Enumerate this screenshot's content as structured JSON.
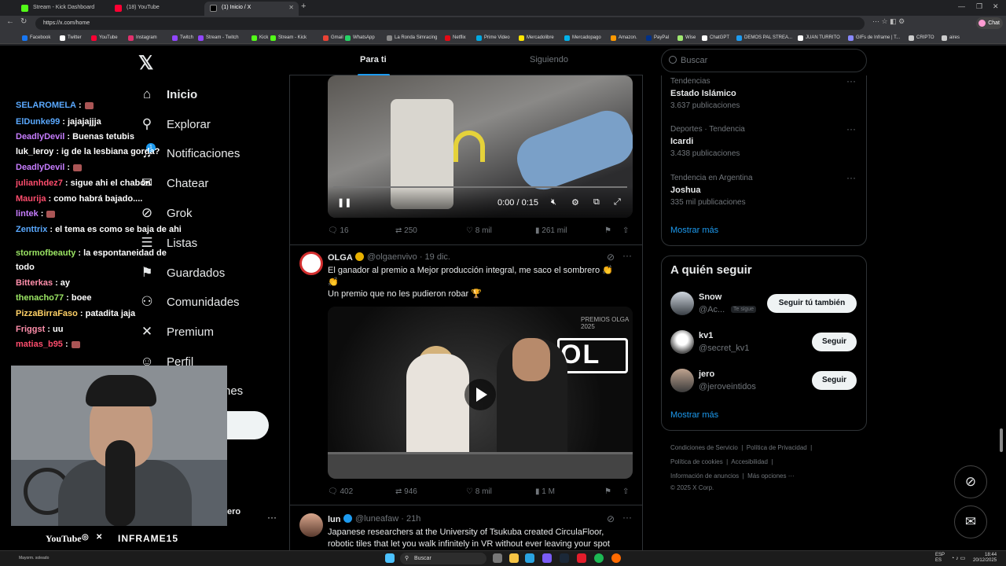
{
  "browser": {
    "tabs": [
      {
        "title": "Stream - Kick Dashboard",
        "color": "#53fc18"
      },
      {
        "title": "(18) YouTube",
        "color": "#ff0033"
      },
      {
        "title": "(1) Inicio / X",
        "color": "#000000"
      }
    ],
    "url": "https://x.com/home",
    "bookmarks": [
      {
        "label": "Facebook",
        "color": "#1877f2"
      },
      {
        "label": "Twitter",
        "color": "#ffffff"
      },
      {
        "label": "YouTube",
        "color": "#ff0033"
      },
      {
        "label": "Instagram",
        "color": "#e1306c"
      },
      {
        "label": "Twitch",
        "color": "#9146ff"
      },
      {
        "label": "Stream - Twitch",
        "color": "#9146ff"
      },
      {
        "label": "Kick",
        "color": "#53fc18"
      },
      {
        "label": "Stream - Kick",
        "color": "#53fc18"
      },
      {
        "label": "Gmail",
        "color": "#ea4335"
      },
      {
        "label": "WhatsApp",
        "color": "#25d366"
      },
      {
        "label": "La Ronda Simracing",
        "color": "#888888"
      },
      {
        "label": "Netflix",
        "color": "#e50914"
      },
      {
        "label": "Prime Video",
        "color": "#00a8e1"
      },
      {
        "label": "Mercadolibre",
        "color": "#ffe600"
      },
      {
        "label": "Mercadopago",
        "color": "#00b1ea"
      },
      {
        "label": "Amazon.",
        "color": "#ff9900"
      },
      {
        "label": "PayPal",
        "color": "#003087"
      },
      {
        "label": "Wise",
        "color": "#9fe870"
      },
      {
        "label": "ChatGPT",
        "color": "#ffffff"
      },
      {
        "label": "DEMOS PAL STREA...",
        "color": "#1d9bf0"
      },
      {
        "label": "JUAN TURRITO",
        "color": "#ffffff"
      },
      {
        "label": "GIFs de Inframe | T...",
        "color": "#8888ff"
      },
      {
        "label": "CRIPTO",
        "color": "#cccccc"
      },
      {
        "label": "aires",
        "color": "#cccccc"
      }
    ],
    "chat_button": "Chat"
  },
  "x_nav": {
    "items": [
      {
        "label": "Inicio",
        "icon": "home-icon",
        "glyph": "⌂"
      },
      {
        "label": "Explorar",
        "icon": "search-icon",
        "glyph": "⚲"
      },
      {
        "label": "Notificaciones",
        "icon": "bell-icon",
        "glyph": "♫"
      },
      {
        "label": "Chatear",
        "icon": "mail-icon",
        "glyph": "✉"
      },
      {
        "label": "Grok",
        "icon": "grok-icon",
        "glyph": "⊘"
      },
      {
        "label": "Listas",
        "icon": "list-icon",
        "glyph": "☰"
      },
      {
        "label": "Guardados",
        "icon": "bookmark-icon",
        "glyph": "⚑"
      },
      {
        "label": "Comunidades",
        "icon": "communities-icon",
        "glyph": "⚇"
      },
      {
        "label": "Premium",
        "icon": "x-icon",
        "glyph": "✕"
      },
      {
        "label": "Perfil",
        "icon": "profile-icon",
        "glyph": "☺"
      }
    ],
    "partial_label": "nes",
    "account_partial": "ero",
    "notification_count": "1"
  },
  "stream_chat": [
    {
      "user": "SELAROMELA",
      "color": "#5aa9ff",
      "msg": ":"
    },
    {
      "user": "ElDunke99",
      "color": "#5aa9ff",
      "msg": ": jajajajjja"
    },
    {
      "user": "DeadlyDevil",
      "color": "#c77dff",
      "msg": ": Buenas tetubis"
    },
    {
      "user": "luk_leroy",
      "color": "#ffffff",
      "msg": ": ig de la lesbiana gorda?"
    },
    {
      "user": "DeadlyDevil",
      "color": "#c77dff",
      "msg": ":"
    },
    {
      "user": "julianhdez7",
      "color": "#ff4d6d",
      "msg": ": sigue ahi el chabon"
    },
    {
      "user": "Maurija",
      "color": "#ff4d6d",
      "msg": ": como habrá bajado...."
    },
    {
      "user": "lintek",
      "color": "#c77dff",
      "msg": ":"
    },
    {
      "user": "Zenttrix",
      "color": "#5aa9ff",
      "msg": ": el tema es como se baja de ahi"
    },
    {
      "user": "stormofbeauty",
      "color": "#9be564",
      "msg": ": la espontaneidad de"
    },
    {
      "user": "",
      "color": "#ffffff",
      "msg": "todo"
    },
    {
      "user": "Bitterkas",
      "color": "#ff8fab",
      "msg": ": ay"
    },
    {
      "user": "thenacho77",
      "color": "#9be564",
      "msg": ": boee"
    },
    {
      "user": "PizzaBirraFaso",
      "color": "#ffd166",
      "msg": ": patadita jaja"
    },
    {
      "user": "Friggst",
      "color": "#ff8fab",
      "msg": ": uu"
    },
    {
      "user": "matias_b95",
      "color": "#ff4d6d",
      "msg": ":"
    }
  ],
  "webcam_footer": {
    "youtube": "YouTube",
    "handle": "INFRAME15"
  },
  "feed": {
    "tabs": [
      "Para ti",
      "Siguiendo"
    ],
    "video1": {
      "time": "0:00 / 0:15"
    },
    "post1_stats": {
      "replies": "16",
      "reposts": "250",
      "likes": "8 mil",
      "views": "261 mil"
    },
    "post2": {
      "name": "OLGA",
      "handle": "@olgaenvivo",
      "date": "· 19 dic.",
      "text1": "El ganador al premio a Mejor producción integral, me saco el sombrero 👏",
      "text2": "👏",
      "text3": "Un premio que no les pudieron robar 🏆",
      "media_label": "PREMIOS OLGA 2025",
      "logo_text": "OL",
      "stats": {
        "replies": "402",
        "reposts": "946",
        "likes": "8 mil",
        "views": "1 M"
      }
    },
    "post3": {
      "name": "lun",
      "handle": "@luneafaw",
      "date": "· 21h",
      "text1": "Japanese researchers at the University of Tsukuba created CirculaFloor,",
      "text2": "robotic tiles that let you walk infinitely in VR without ever leaving your spot"
    }
  },
  "sidebar": {
    "search_placeholder": "Buscar",
    "trends": [
      {
        "context": "Tendencias",
        "name": "Estado Islámico",
        "count": "3.637 publicaciones"
      },
      {
        "context": "Deportes · Tendencia",
        "name": "Icardi",
        "count": "3.438 publicaciones"
      },
      {
        "context": "Tendencia en Argentina",
        "name": "Joshua",
        "count": "335 mil publicaciones"
      }
    ],
    "show_more": "Mostrar más",
    "who_to_follow_title": "A quién seguir",
    "follow": [
      {
        "name": "Snow",
        "handle": "@Ac...",
        "button": "Seguir tú también",
        "tag": "Te sigue"
      },
      {
        "name": "kv1",
        "handle": "@secret_kv1",
        "button": "Seguir"
      },
      {
        "name": "jero",
        "handle": "@jeroveintidos",
        "button": "Seguir"
      }
    ],
    "footer": {
      "line1": [
        "Condiciones de Servicio",
        "Política de Privacidad"
      ],
      "line2": [
        "Política de cookies",
        "Accesibilidad"
      ],
      "line3": [
        "Información de anuncios",
        "Más opciones ···"
      ],
      "copyright": "© 2025 X Corp."
    }
  },
  "taskbar": {
    "search": "Buscar",
    "weather": "Mayorm. soleado",
    "lang": "ESP",
    "lang2": "ES",
    "time": "18:44",
    "date": "20/12/2025"
  },
  "colors": {
    "accent": "#1d9bf0",
    "border": "#2f3336",
    "muted": "#71767b"
  }
}
